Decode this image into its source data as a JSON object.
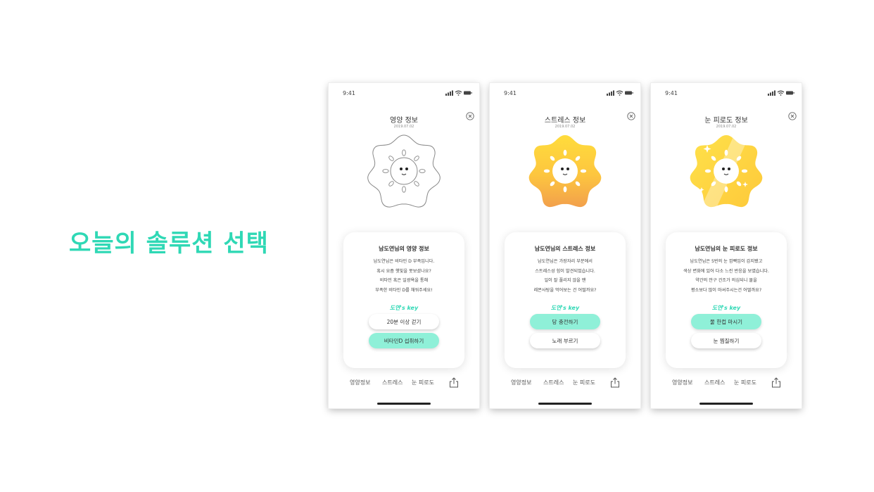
{
  "headline": "오늘의 솔루션 선택",
  "colors": {
    "accent": "#2fd8b5",
    "mint_button": "#8ff0d8",
    "sun_top": "#ffd83a",
    "sun_bottom": "#f2a24a"
  },
  "screens": [
    {
      "status_time": "9:41",
      "title": "영양 정보",
      "date": "2019.07.02",
      "character_state": "outline",
      "card": {
        "title": "남도연님의 영양 정보",
        "lines": [
          "남도연님은 비타민 D 부족입니다.",
          "혹시 요즘 햇빛을 못보셨나요?",
          "비타민 혹은 일광욕을 통해",
          "부족한 비타민 D를 채워주세요!"
        ],
        "key_label": "도연's key",
        "buttons": [
          {
            "label": "20분 이상 걷기",
            "style": "white"
          },
          {
            "label": "비타민D 섭취하기",
            "style": "mint"
          }
        ]
      },
      "tabs": [
        "영양정보",
        "스트레스",
        "눈 피로도"
      ]
    },
    {
      "status_time": "9:41",
      "title": "스트레스 정보",
      "date": "2019.07.02",
      "character_state": "gradient",
      "card": {
        "title": "남도연님의 스트레스 정보",
        "lines": [
          "남도연님은 가장자리 부분에서",
          "스트레스성 힘이 발견되었습니다.",
          "일이 잘 풀리지 않을 땐",
          "레몬사탕을 먹어보는 건 어떨까요?"
        ],
        "key_label": "도연's key",
        "buttons": [
          {
            "label": "당 충전하기",
            "style": "mint"
          },
          {
            "label": "노래 부르기",
            "style": "white"
          }
        ]
      },
      "tabs": [
        "영양정보",
        "스트레스",
        "눈 피로도"
      ]
    },
    {
      "status_time": "9:41",
      "title": "눈 피로도 정보",
      "date": "2019.07.02",
      "character_state": "sparkle",
      "card": {
        "title": "남도연님의 눈 피로도 정보",
        "lines": [
          "남도연님은 5번의 눈 깜빡임이 감지됐고",
          "색상 변화에 있어 다소 느린 반응을 보였습니다.",
          "약간의 안구 건조가 의심되니 물을",
          "평소보다 많이 마셔주시는건 어떨까요?"
        ],
        "key_label": "도연's key",
        "buttons": [
          {
            "label": "물 한컵 마시기",
            "style": "mint"
          },
          {
            "label": "눈 찜질하기",
            "style": "white"
          }
        ]
      },
      "tabs": [
        "영양정보",
        "스트레스",
        "눈 피로도"
      ]
    }
  ]
}
